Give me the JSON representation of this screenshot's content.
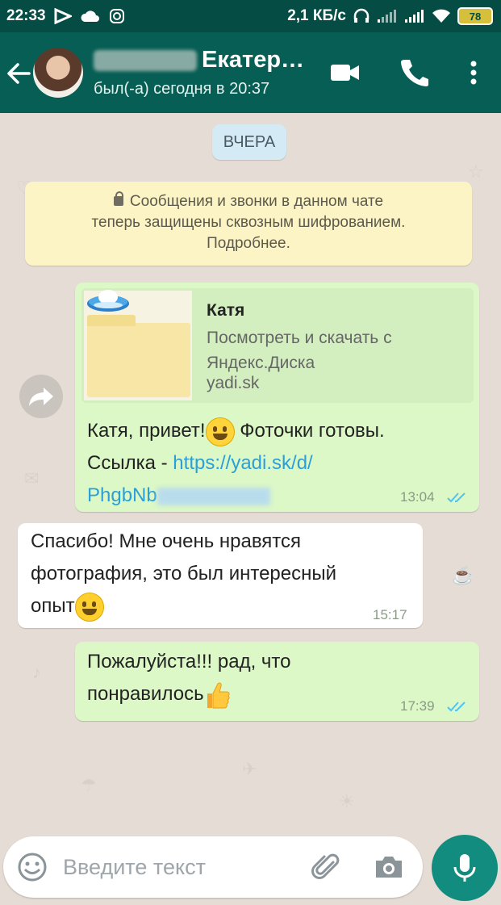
{
  "status_bar": {
    "time": "22:33",
    "speed": "2,1 КБ/с",
    "battery": "78",
    "icons": [
      "play-icon",
      "cloud-icon",
      "instagram-icon",
      "headset-icon",
      "signal-icon",
      "signal-icon",
      "wifi-icon",
      "battery-icon"
    ]
  },
  "header": {
    "contact_name": "Екатер…",
    "last_seen": "был(-а) сегодня в 20:37",
    "icons": [
      "back-arrow-icon",
      "video-call-icon",
      "phone-call-icon",
      "more-vert-icon"
    ]
  },
  "chat": {
    "date_chip": "ВЧЕРА",
    "encryption_notice": {
      "line1": "Сообщения и звонки в данном чате",
      "line2": "теперь защищены сквозным шифрованием.",
      "line3": "Подробнее."
    },
    "messages": [
      {
        "direction": "out",
        "link_preview": {
          "title": "Катя",
          "description_line1": "Посмотреть и скачать с",
          "description_line2": "Яндекс.Диска",
          "domain": "yadi.sk"
        },
        "text_line1_a": "Катя, привет!",
        "text_line1_b": " Фоточки готовы.",
        "text_line2_prefix": "Ссылка - ",
        "link_line1": "https://yadi.sk/d/",
        "link_line2": "PhgbNb",
        "time": "13:04",
        "status": "read"
      },
      {
        "direction": "in",
        "text_line1": "Спасибо! Мне очень нравятся",
        "text_line2": "фотография, это был интересный",
        "text_line3": "опыт",
        "time": "15:17"
      },
      {
        "direction": "out",
        "text_line1": "Пожалуйста!!! рад, что",
        "text_line2": "понравилось",
        "time": "17:39",
        "status": "read"
      }
    ]
  },
  "composer": {
    "placeholder": "Введите текст",
    "icons": [
      "emoji-icon",
      "attach-icon",
      "camera-icon",
      "mic-icon"
    ]
  },
  "colors": {
    "toolbar": "#075e54",
    "status_bar": "#054d44",
    "outgoing_bubble": "#dcf8c6",
    "incoming_bubble": "#ffffff",
    "chat_background": "#e5ddd5",
    "link": "#2b9fd9",
    "read_ticks": "#4fc3f7",
    "mic_button": "#128c7e"
  }
}
